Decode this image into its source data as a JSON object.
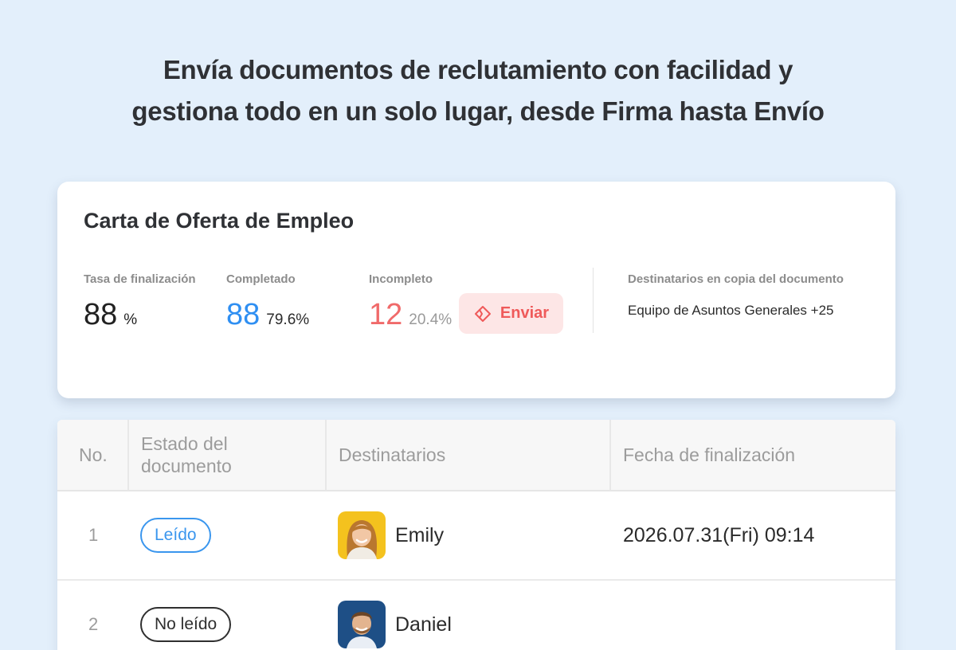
{
  "headline": {
    "line1": "Envía documentos de reclutamiento con facilidad y",
    "line2": "gestiona todo en un solo lugar, desde Firma hasta Envío"
  },
  "summary": {
    "title": "Carta de Oferta de Empleo",
    "completion_rate": {
      "label": "Tasa de finalización",
      "value": "88",
      "unit": "%"
    },
    "completed": {
      "label": "Completado",
      "value": "88",
      "percent": "79.6%"
    },
    "incomplete": {
      "label": "Incompleto",
      "value": "12",
      "percent": "20.4%"
    },
    "send_button": {
      "label": "Enviar",
      "icon": "send-icon"
    },
    "cc": {
      "label": "Destinatarios en copia del documento",
      "value": "Equipo de Asuntos Generales +25"
    }
  },
  "table": {
    "columns": [
      "No.",
      "Estado del documento",
      "Destinatarios",
      "Fecha de finalización"
    ],
    "rows": [
      {
        "no": "1",
        "status": "Leído",
        "recipient": "Emily",
        "date": "2026.07.31(Fri) 09:14"
      },
      {
        "no": "2",
        "status": "No leído",
        "recipient": "Daniel",
        "date": ""
      }
    ]
  },
  "colors": {
    "background": "#e3effb",
    "accent_blue": "#2f8ff2",
    "accent_red": "#f06a6a",
    "send_button_bg": "#fde6e6"
  }
}
